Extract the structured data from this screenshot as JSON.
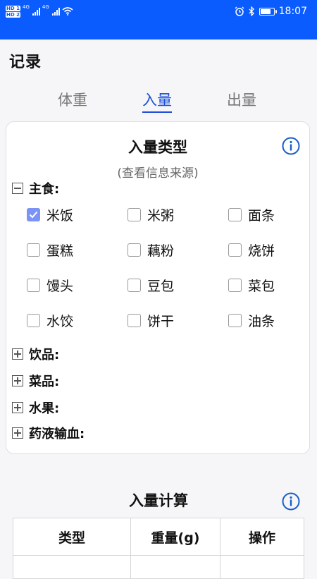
{
  "statusbar": {
    "sim1": "HD 1",
    "sim2": "HD 2",
    "net1": "4G",
    "net2": "4G",
    "time": "18:07",
    "battery_level": 0.8,
    "icons": [
      "alarm-icon",
      "bluetooth-icon",
      "battery-icon",
      "wifi-icon",
      "signal-icon"
    ]
  },
  "header": {
    "title": "记录"
  },
  "tabs": [
    {
      "label": "体重",
      "active": false
    },
    {
      "label": "入量",
      "active": true
    },
    {
      "label": "出量",
      "active": false
    }
  ],
  "intake_type": {
    "title": "入量类型",
    "source_link": "(查看信息来源)",
    "categories": [
      {
        "label": "主食:",
        "expanded": true,
        "items": [
          {
            "label": "米饭",
            "checked": true
          },
          {
            "label": "米粥",
            "checked": false
          },
          {
            "label": "面条",
            "checked": false
          },
          {
            "label": "蛋糕",
            "checked": false
          },
          {
            "label": "藕粉",
            "checked": false
          },
          {
            "label": "烧饼",
            "checked": false
          },
          {
            "label": "馒头",
            "checked": false
          },
          {
            "label": "豆包",
            "checked": false
          },
          {
            "label": "菜包",
            "checked": false
          },
          {
            "label": "水饺",
            "checked": false
          },
          {
            "label": "饼干",
            "checked": false
          },
          {
            "label": "油条",
            "checked": false
          }
        ]
      },
      {
        "label": "饮品:",
        "expanded": false
      },
      {
        "label": "菜品:",
        "expanded": false
      },
      {
        "label": "水果:",
        "expanded": false
      },
      {
        "label": "药液输血:",
        "expanded": false
      }
    ]
  },
  "intake_calc": {
    "title": "入量计算",
    "columns": [
      "类型",
      "重量(g)",
      "操作"
    ]
  },
  "colors": {
    "statusbar_bg": "#0a5cff",
    "accent": "#1a4fd8",
    "checkbox_checked": "#7b93f4",
    "info_icon": "#1a5fc7"
  }
}
